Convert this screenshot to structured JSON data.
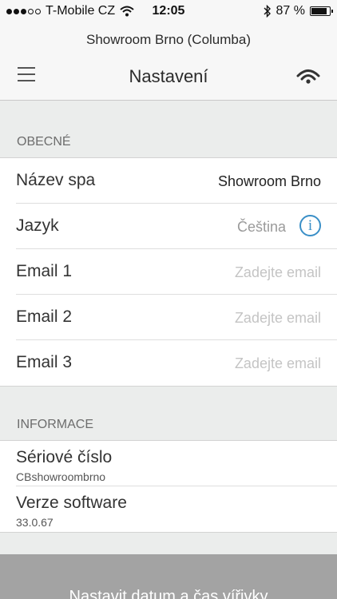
{
  "status_bar": {
    "carrier": "T-Mobile CZ",
    "time": "12:05",
    "battery": "87 %",
    "battery_level": 0.87
  },
  "header": {
    "subtitle": "Showroom Brno (Columba)",
    "title": "Nastavení"
  },
  "general": {
    "section_label": "OBECNÉ",
    "rows": [
      {
        "label": "Název spa",
        "value": "Showroom Brno"
      },
      {
        "label": "Jazyk",
        "value": "Čeština"
      },
      {
        "label": "Email 1",
        "placeholder": "Zadejte email"
      },
      {
        "label": "Email 2",
        "placeholder": "Zadejte email"
      },
      {
        "label": "Email 3",
        "placeholder": "Zadejte email"
      }
    ]
  },
  "info": {
    "section_label": "INFORMACE",
    "rows": [
      {
        "label": "Sériové číslo",
        "value": "CBshowroombrno"
      },
      {
        "label": "Verze software",
        "value": "33.0.67"
      }
    ]
  },
  "bottom_button": {
    "label": "Nastavit datum a čas vířivky"
  },
  "icons": {
    "menu": "hamburger-menu-icon",
    "connection": "wifi-signal-icon",
    "info": "info-icon",
    "bluetooth": "bluetooth-icon",
    "wifi_status": "wifi-status-icon"
  },
  "colors": {
    "accent": "#3a8fc7",
    "background": "#ebedec",
    "button": "#a3a3a3"
  }
}
